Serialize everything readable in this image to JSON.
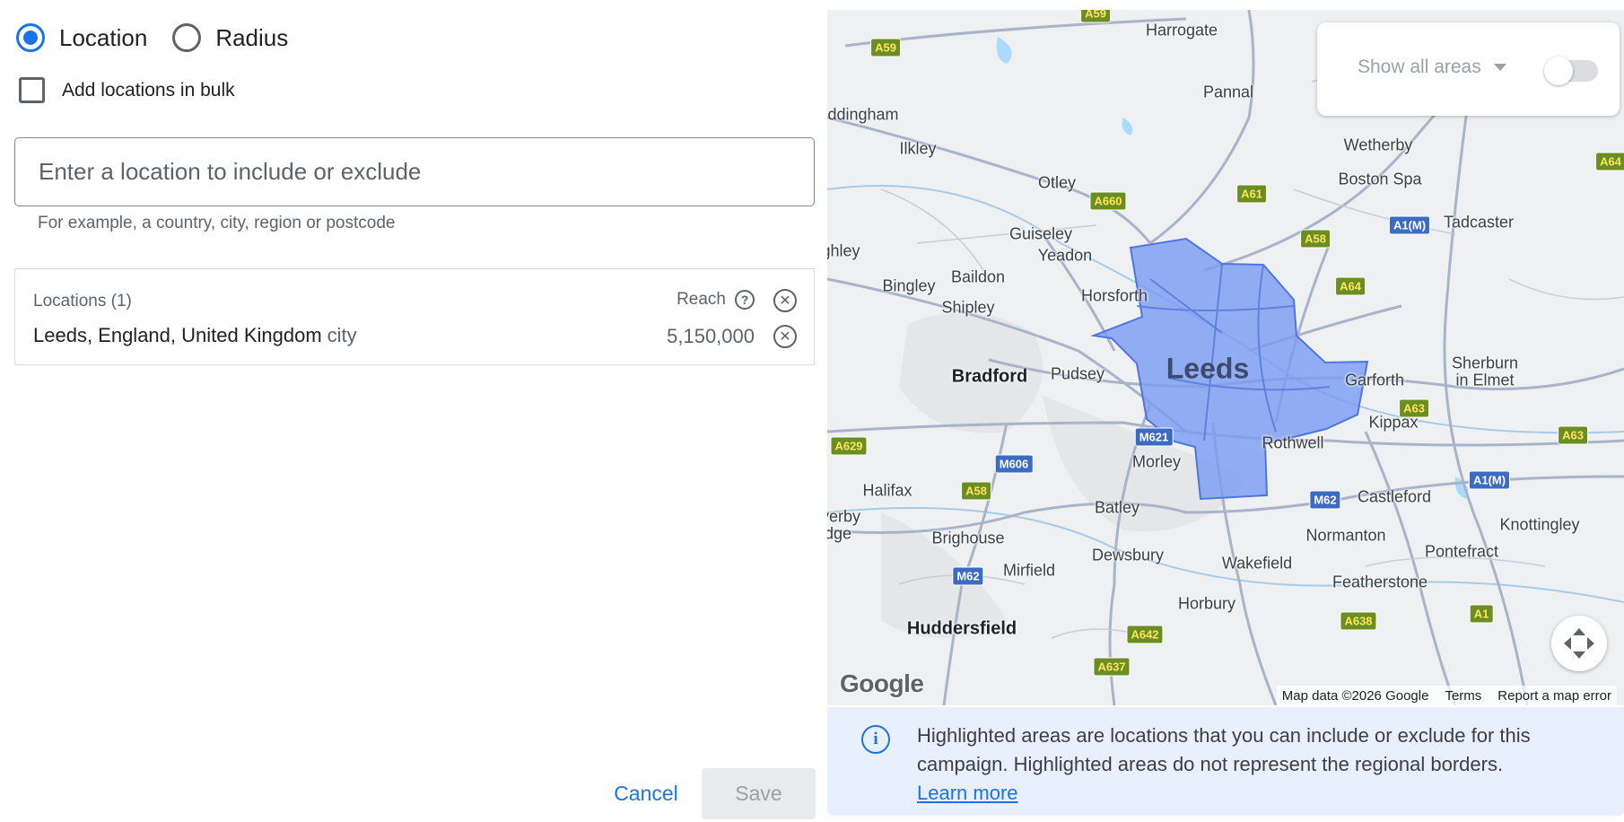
{
  "targeting": {
    "options": [
      {
        "label": "Location",
        "selected": true
      },
      {
        "label": "Radius",
        "selected": false
      }
    ],
    "bulk_label": "Add locations in bulk"
  },
  "search": {
    "placeholder": "Enter a location to include or exclude",
    "helper": "For example, a country, city, region or postcode"
  },
  "locations": {
    "header": "Locations (1)",
    "reach_label": "Reach",
    "items": [
      {
        "name": "Leeds, England, United Kingdom",
        "type": "city",
        "reach": "5,150,000"
      }
    ]
  },
  "map": {
    "show_all_label": "Show all areas",
    "show_all_enabled": false,
    "highlight_color": "#7b9cf1",
    "highlighted_area": "Leeds",
    "labels": {
      "harrogate": "Harrogate",
      "pannal": "Pannal",
      "addingham": "ddingham",
      "ilkley": "Ilkley",
      "otley": "Otley",
      "wetherby": "Wetherby",
      "boston_spa": "Boston Spa",
      "tadcaster": "Tadcaster",
      "guiseley": "Guiseley",
      "yeadon": "Yeadon",
      "keighley": "ghley",
      "baildon": "Baildon",
      "bingley": "Bingley",
      "shipley": "Shipley",
      "horsforth": "Horsforth",
      "leeds": "Leeds",
      "bradford": "Bradford",
      "pudsey": "Pudsey",
      "garforth": "Garforth",
      "sherburn": "Sherburn",
      "sherburn2": "in Elmet",
      "kippax": "Kippax",
      "rothwell": "Rothwell",
      "morley": "Morley",
      "halifax": "Halifax",
      "batley": "Batley",
      "castleford": "Castleford",
      "knottingley": "Knottingley",
      "sowerby": "verby",
      "sowerby2": "dge",
      "brighouse": "Brighouse",
      "normanton": "Normanton",
      "dewsbury": "Dewsbury",
      "pontefract": "Pontefract",
      "wakefield": "Wakefield",
      "mirfield": "Mirfield",
      "featherstone": "Featherstone",
      "horbury": "Horbury",
      "huddersfield": "Huddersfield"
    },
    "roads": {
      "a59_top": "A59",
      "a59": "A59",
      "a660": "A660",
      "a61": "A61",
      "a1m_n": "A1(M)",
      "a58_e": "A58",
      "a64": "A64",
      "a63": "A63",
      "a63_e": "A63",
      "a629": "A629",
      "m621": "M621",
      "m606": "M606",
      "a58_w": "A58",
      "a1m_s": "A1(M)",
      "m62_e": "M62",
      "m62_w": "M62",
      "a638": "A638",
      "a1": "A1",
      "a642": "A642",
      "a637": "A637",
      "a64_edge": "A64"
    },
    "google_logo": "Google",
    "attribution": {
      "data": "Map data ©2026 Google",
      "terms": "Terms",
      "report": "Report a map error"
    }
  },
  "info": {
    "text": "Highlighted areas are locations that you can include or exclude for this campaign. Highlighted areas do not represent the regional borders.",
    "link": "Learn more"
  },
  "actions": {
    "cancel": "Cancel",
    "save": "Save"
  }
}
